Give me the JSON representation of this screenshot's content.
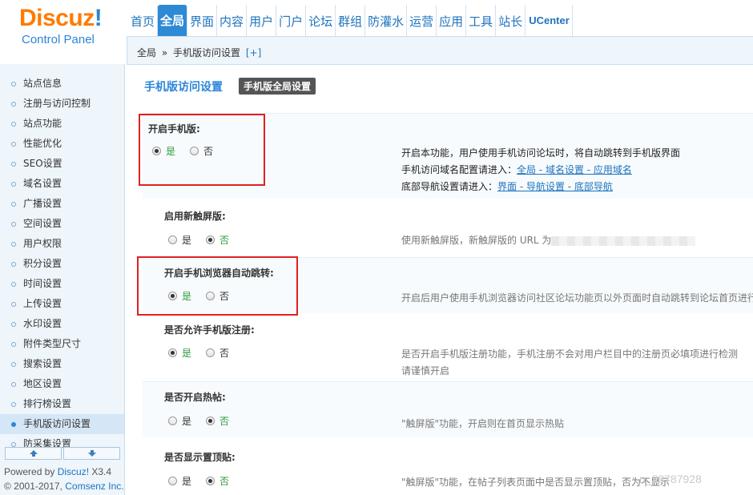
{
  "logo": {
    "brand": "Discuz",
    "bang": "!",
    "subtitle": "Control Panel"
  },
  "topnav": {
    "items": [
      "首页",
      "全局",
      "界面",
      "内容",
      "用户",
      "门户",
      "论坛",
      "群组",
      "防灌水",
      "运营",
      "应用",
      "工具",
      "站长",
      "UCenter"
    ],
    "active_index": 1
  },
  "breadcrumb": {
    "root": "全局",
    "sep": "»",
    "current": "手机版访问设置",
    "add": "[+]"
  },
  "sidebar": {
    "items": [
      "站点信息",
      "注册与访问控制",
      "站点功能",
      "性能优化",
      "SEO设置",
      "域名设置",
      "广播设置",
      "空间设置",
      "用户权限",
      "积分设置",
      "时间设置",
      "上传设置",
      "水印设置",
      "附件类型尺寸",
      "搜索设置",
      "地区设置",
      "排行榜设置",
      "手机版访问设置",
      "防采集设置"
    ],
    "active_index": 17
  },
  "footer": {
    "powered_prefix": "Powered by ",
    "powered_link": "Discuz!",
    "powered_version": " X3.4",
    "copyright_prefix": "© 2001-2017, ",
    "copyright_link": "Comsenz Inc."
  },
  "main": {
    "title": "手机版访问设置",
    "tab": "手机版全局设置",
    "settings": [
      {
        "label": "开启手机版:",
        "yes": "是",
        "no": "否",
        "checked": "yes",
        "desc_line1": "开启本功能，用户使用手机访问论坛时，将自动跳转到手机版界面",
        "desc_line2_prefix": "手机访问域名配置请进入：",
        "desc_line2_link": "全局 - 域名设置 - 应用域名",
        "desc_line3_prefix": "底部导航设置请进入：",
        "desc_line3_link": "界面 - 导航设置 - 底部导航"
      },
      {
        "label": "启用新触屏版:",
        "yes": "是",
        "no": "否",
        "checked": "no",
        "desc": "使用新触屏版，新触屏版的 URL 为"
      },
      {
        "label": "开启手机浏览器自动跳转:",
        "yes": "是",
        "no": "否",
        "checked": "yes",
        "desc": "开启后用户使用手机浏览器访问社区论坛功能页以外页面时自动跳转到论坛首页进行"
      },
      {
        "label": "是否允许手机版注册:",
        "yes": "是",
        "no": "否",
        "checked": "yes",
        "desc_line1": "是否开启手机版注册功能，手机注册不会对用户栏目中的注册页必填项进行检测",
        "desc_line2": "请谨慎开启"
      },
      {
        "label": "是否开启热帖:",
        "yes": "是",
        "no": "否",
        "checked": "no",
        "desc": "\"触屏版\"功能，开启则在首页显示热贴"
      },
      {
        "label": "是否显示置顶贴:",
        "yes": "是",
        "no": "否",
        "checked": "no",
        "desc": "\"触屏版\"功能，在帖子列表页面中是否显示置顶贴，否为不显示"
      }
    ]
  },
  "watermark": "n_38787928"
}
